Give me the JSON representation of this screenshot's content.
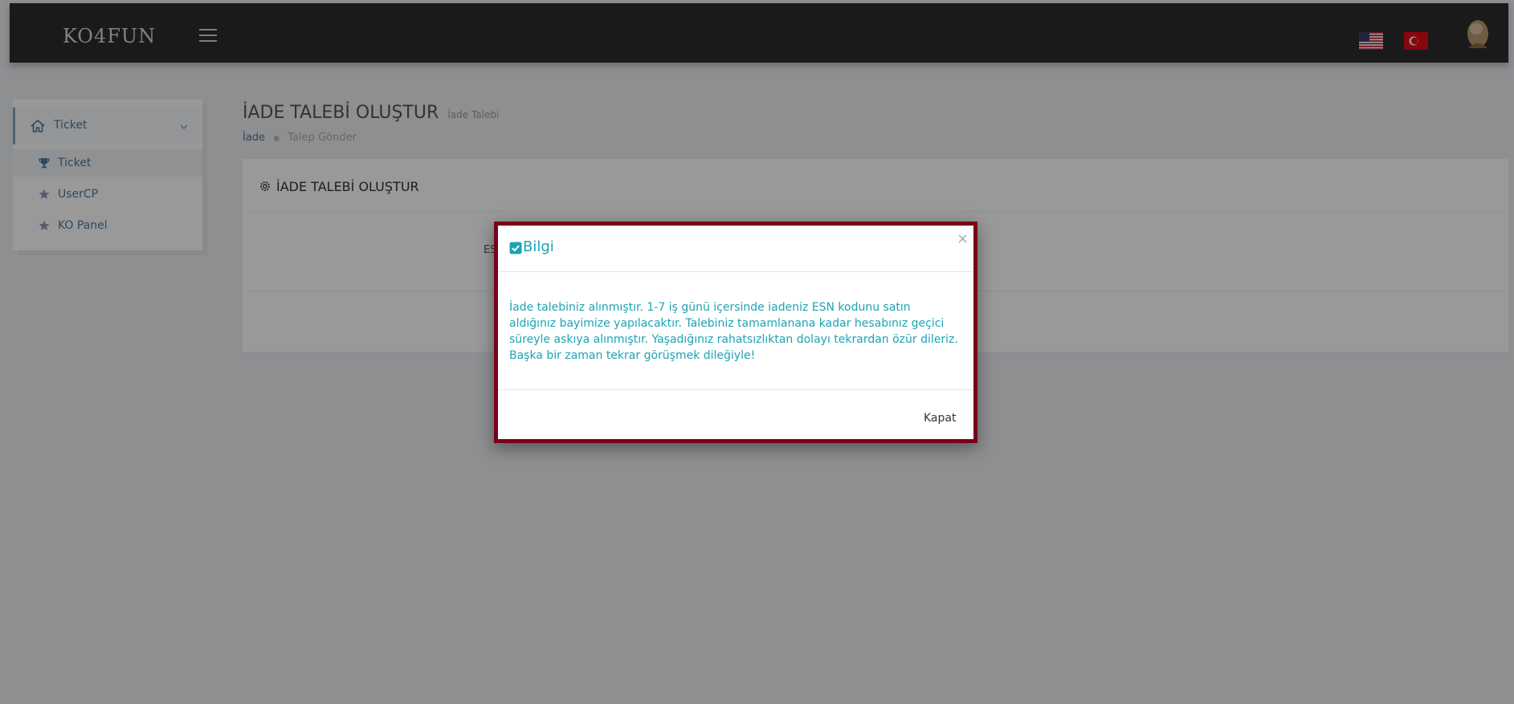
{
  "topbar": {
    "logo_text": "KO4FUN",
    "flags": [
      "us-flag-icon",
      "tr-flag-icon"
    ]
  },
  "sidebar": {
    "header_label": "Ticket",
    "items": [
      {
        "label": "Ticket",
        "icon": "trophy-icon"
      },
      {
        "label": "UserCP",
        "icon": "star-icon"
      },
      {
        "label": "KO Panel",
        "icon": "star-icon"
      }
    ]
  },
  "page": {
    "title": "İADE TALEBİ OLUŞTUR",
    "subtitle": "İade Talebi",
    "breadcrumb": [
      "İade",
      "Talep Gönder"
    ]
  },
  "portlet": {
    "title": "İADE TALEBİ OLUŞTUR",
    "field_label": "ES"
  },
  "modal": {
    "title": "Bilgi",
    "close_symbol": "×",
    "body": "İade talebiniz alınmıştır. 1-7 iş günü içersinde iadeniz ESN kodunu satın aldığınız bayimize yapılacaktır. Talebiniz tamamlanana kadar hesabınız geçici süreyle askıya alınmıştır. Yaşadığınız rahatsızlıktan dolayı tekrardan özür dileriz. Başka bir zaman tekrar görüşmek dileğiyle!",
    "button_label": "Kapat"
  },
  "colors": {
    "accent": "#1ba4b5",
    "modal_border": "#7a0019",
    "link": "#4e79a4",
    "topbar": "#2c2c2c"
  }
}
